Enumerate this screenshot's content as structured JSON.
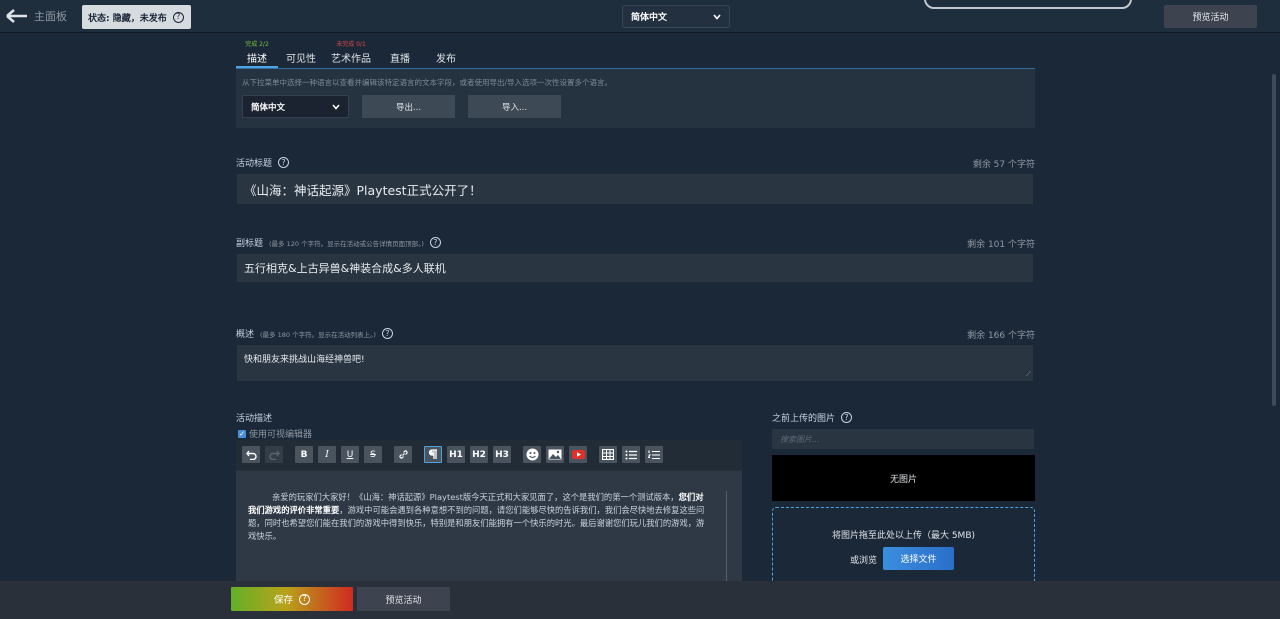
{
  "header": {
    "back_label": "主面板",
    "status_label": "状态: 隐藏，未发布",
    "language_select": "简体中文",
    "preview_button": "预览活动"
  },
  "tabs": [
    {
      "badge": "完成 2/2",
      "label": "描述"
    },
    {
      "badge": "",
      "label": "可见性"
    },
    {
      "badge": "未完成 0/1",
      "label": "艺术作品"
    },
    {
      "badge": "",
      "label": "直播"
    },
    {
      "badge": "",
      "label": "发布"
    }
  ],
  "language_panel": {
    "hint": "从下拉菜单中选择一种语言以查看并编辑该特定语言的文本字段，或者使用导出/导入选项一次性设置多个语言。",
    "select_value": "简体中文",
    "export_button": "导出...",
    "import_button": "导入..."
  },
  "event_title": {
    "label": "活动标题",
    "remaining": "剩余 57 个字符",
    "value": "《山海：神话起源》Playtest正式公开了！"
  },
  "subtitle": {
    "label": "副标题",
    "note": "(最多 120 个字符。显示在活动或公告详情页面顶部。)",
    "remaining": "剩余 101 个字符",
    "value": "五行相克&上古异兽&神装合成&多人联机"
  },
  "summary": {
    "label": "概述",
    "note": "(最多 180 个字符。显示在活动列表上。)",
    "remaining": "剩余 166 个字符",
    "value": "快和朋友来挑战山海经神兽吧!"
  },
  "description": {
    "label": "活动描述",
    "visual_editor_label": "使用可视编辑器",
    "toolbar": {
      "bold": "B",
      "italic": "I",
      "underline": "U",
      "strike": "S",
      "h1": "H1",
      "h2": "H2",
      "h3": "H3"
    },
    "body_part1": "亲爱的玩家们大家好！《山海：神话起源》Playtest版今天正式和大家见面了，这个是我们的第一个测试版本，",
    "body_bold": "您们对我们游戏的评价非常重要",
    "body_part2": "，游戏中可能会遇到各种意想不到的问题，请您们能够尽快的告诉我们，我们会尽快地去修复这些问题，同时也希望您们能在我们的游戏中得到快乐，特别是和朋友们能拥有一个快乐的时光。最后谢谢您们玩儿我们的游戏，游戏快乐。"
  },
  "images": {
    "label": "之前上传的图片",
    "search_placeholder": "搜索图片...",
    "no_images": "无图片",
    "drop_text": "将图片拖至此处以上传（最大 5MB)",
    "browse_text": "或浏览",
    "choose_button": "选择文件"
  },
  "footer": {
    "save_button": "保存",
    "preview_button": "预览活动"
  },
  "colors": {
    "background": "#1b2838",
    "accent_blue": "#4fa3e3",
    "complete_green": "#7ac143",
    "incomplete_red": "#e04848"
  }
}
